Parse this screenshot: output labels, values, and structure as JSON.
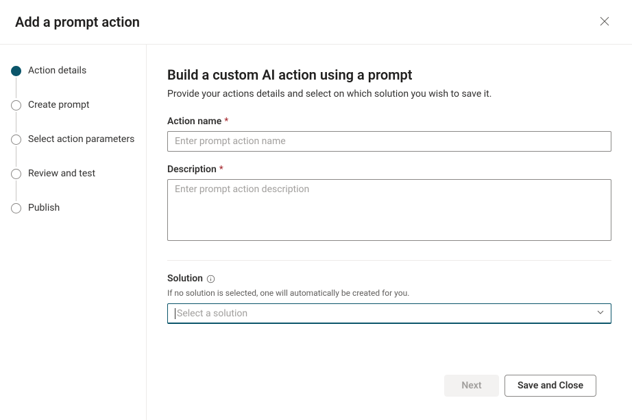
{
  "header": {
    "title": "Add a prompt action"
  },
  "sidebar": {
    "steps": [
      {
        "label": "Action details",
        "active": true
      },
      {
        "label": "Create prompt",
        "active": false
      },
      {
        "label": "Select action parameters",
        "active": false
      },
      {
        "label": "Review and test",
        "active": false
      },
      {
        "label": "Publish",
        "active": false
      }
    ]
  },
  "main": {
    "title": "Build a custom AI action using a prompt",
    "subtitle": "Provide your actions details and select on which solution you wish to save it.",
    "fields": {
      "action_name": {
        "label": "Action name",
        "required_mark": "*",
        "placeholder": "Enter prompt action name",
        "value": ""
      },
      "description": {
        "label": "Description",
        "required_mark": "*",
        "placeholder": "Enter prompt action description",
        "value": ""
      },
      "solution": {
        "label": "Solution",
        "help": "If no solution is selected, one will automatically be created for you.",
        "placeholder": "Select a solution",
        "value": ""
      }
    }
  },
  "footer": {
    "next_label": "Next",
    "save_close_label": "Save and Close"
  }
}
